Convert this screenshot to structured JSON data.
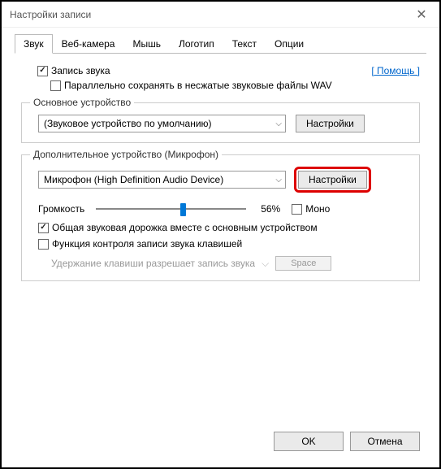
{
  "window": {
    "title": "Настройки записи"
  },
  "tabs": [
    "Звук",
    "Веб-камера",
    "Мышь",
    "Логотип",
    "Текст",
    "Опции"
  ],
  "active_tab": 0,
  "help_link": "[ Помощь ]",
  "checkboxes": {
    "record_sound": {
      "label": "Запись звука",
      "checked": true
    },
    "save_wav": {
      "label": "Параллельно сохранять в несжатые звуковые файлы WAV",
      "checked": false
    },
    "common_track": {
      "label": "Общая звуковая дорожка вместе с основным устройством",
      "checked": true
    },
    "key_control": {
      "label": "Функция контроля записи звука клавишей",
      "checked": false
    },
    "mono": {
      "label": "Моно",
      "checked": false
    }
  },
  "primary": {
    "legend": "Основное устройство",
    "device": "(Звуковое устройство по умолчанию)",
    "settings_btn": "Настройки"
  },
  "secondary": {
    "legend": "Дополнительное устройство (Микрофон)",
    "device": "Микрофон (High Definition Audio Device)",
    "settings_btn": "Настройки",
    "volume_label": "Громкость",
    "volume_pct": "56%",
    "volume_value": 56,
    "hotkey_label": "Удержание клавиши разрешает запись звука",
    "hotkey_value": "Space"
  },
  "buttons": {
    "ok": "OK",
    "cancel": "Отмена"
  }
}
